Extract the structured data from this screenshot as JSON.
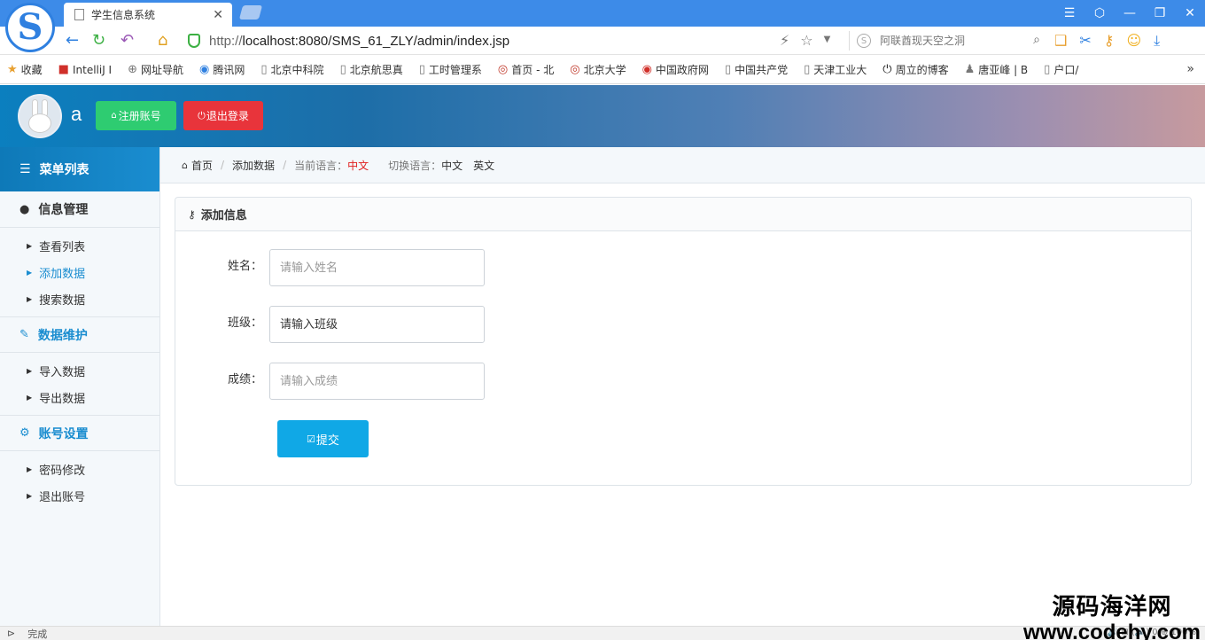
{
  "browser": {
    "tab_title": "学生信息系统",
    "tab_close": "✕",
    "logo_letter": "S",
    "url_prefix": "http://",
    "url_host": "localhost",
    "url_rest": ":8080/SMS_61_ZLY/admin/index.jsp",
    "search_placeholder": "阿联酋现天空之洞",
    "window_controls": [
      "☰",
      "⬡",
      "—",
      "❐",
      "✕"
    ]
  },
  "bookmarks": [
    {
      "icon": "★",
      "label": "收藏"
    },
    {
      "icon": "■",
      "label": "IntelliJ I"
    },
    {
      "icon": "⊕",
      "label": "网址导航"
    },
    {
      "icon": "◉",
      "label": "腾讯网"
    },
    {
      "icon": "▯",
      "label": "北京中科院"
    },
    {
      "icon": "▯",
      "label": "北京航思真"
    },
    {
      "icon": "▯",
      "label": "工时管理系"
    },
    {
      "icon": "◎",
      "label": "首页 - 北"
    },
    {
      "icon": "◎",
      "label": "北京大学"
    },
    {
      "icon": "◉",
      "label": "中国政府网"
    },
    {
      "icon": "▯",
      "label": "中国共产党"
    },
    {
      "icon": "▯",
      "label": "天津工业大"
    },
    {
      "icon": "⏻",
      "label": "周立的博客"
    },
    {
      "icon": "♟",
      "label": "唐亚峰 | B"
    },
    {
      "icon": "▯",
      "label": "户口/"
    }
  ],
  "header": {
    "username": "a",
    "register_label": "注册账号",
    "logout_label": "退出登录"
  },
  "sidebar": {
    "title": "菜单列表",
    "groups": [
      {
        "label": "信息管理",
        "items": [
          "查看列表",
          "添加数据",
          "搜索数据"
        ]
      },
      {
        "label": "数据维护",
        "items": [
          "导入数据",
          "导出数据"
        ]
      },
      {
        "label": "账号设置",
        "items": [
          "密码修改",
          "退出账号"
        ]
      }
    ]
  },
  "breadcrumb": {
    "home": "首页",
    "current": "添加数据",
    "lang_label": "当前语言：",
    "lang_value": "中文",
    "switch_label": "切换语言：",
    "lang_zh": "中文",
    "lang_en": "英文"
  },
  "form": {
    "panel_title": "添加信息",
    "fields": [
      {
        "label": "姓名：",
        "placeholder": "请输入姓名"
      },
      {
        "label": "班级：",
        "placeholder": "请输入班级"
      },
      {
        "label": "成绩：",
        "placeholder": "请输入成绩"
      }
    ],
    "submit_label": "提交"
  },
  "status": {
    "text": "完成",
    "right": "🔊  ⊞  (🔊) 0  ⊕ 100%"
  },
  "watermark": {
    "line1": "源码海洋网",
    "line2": "www.codehy.com"
  },
  "colors": {
    "accent": "#1a8dd0",
    "register_button": "#2ecc71",
    "logout_button": "#e8343b",
    "submit_button": "#10a8e6",
    "language_highlight": "#e02020"
  }
}
